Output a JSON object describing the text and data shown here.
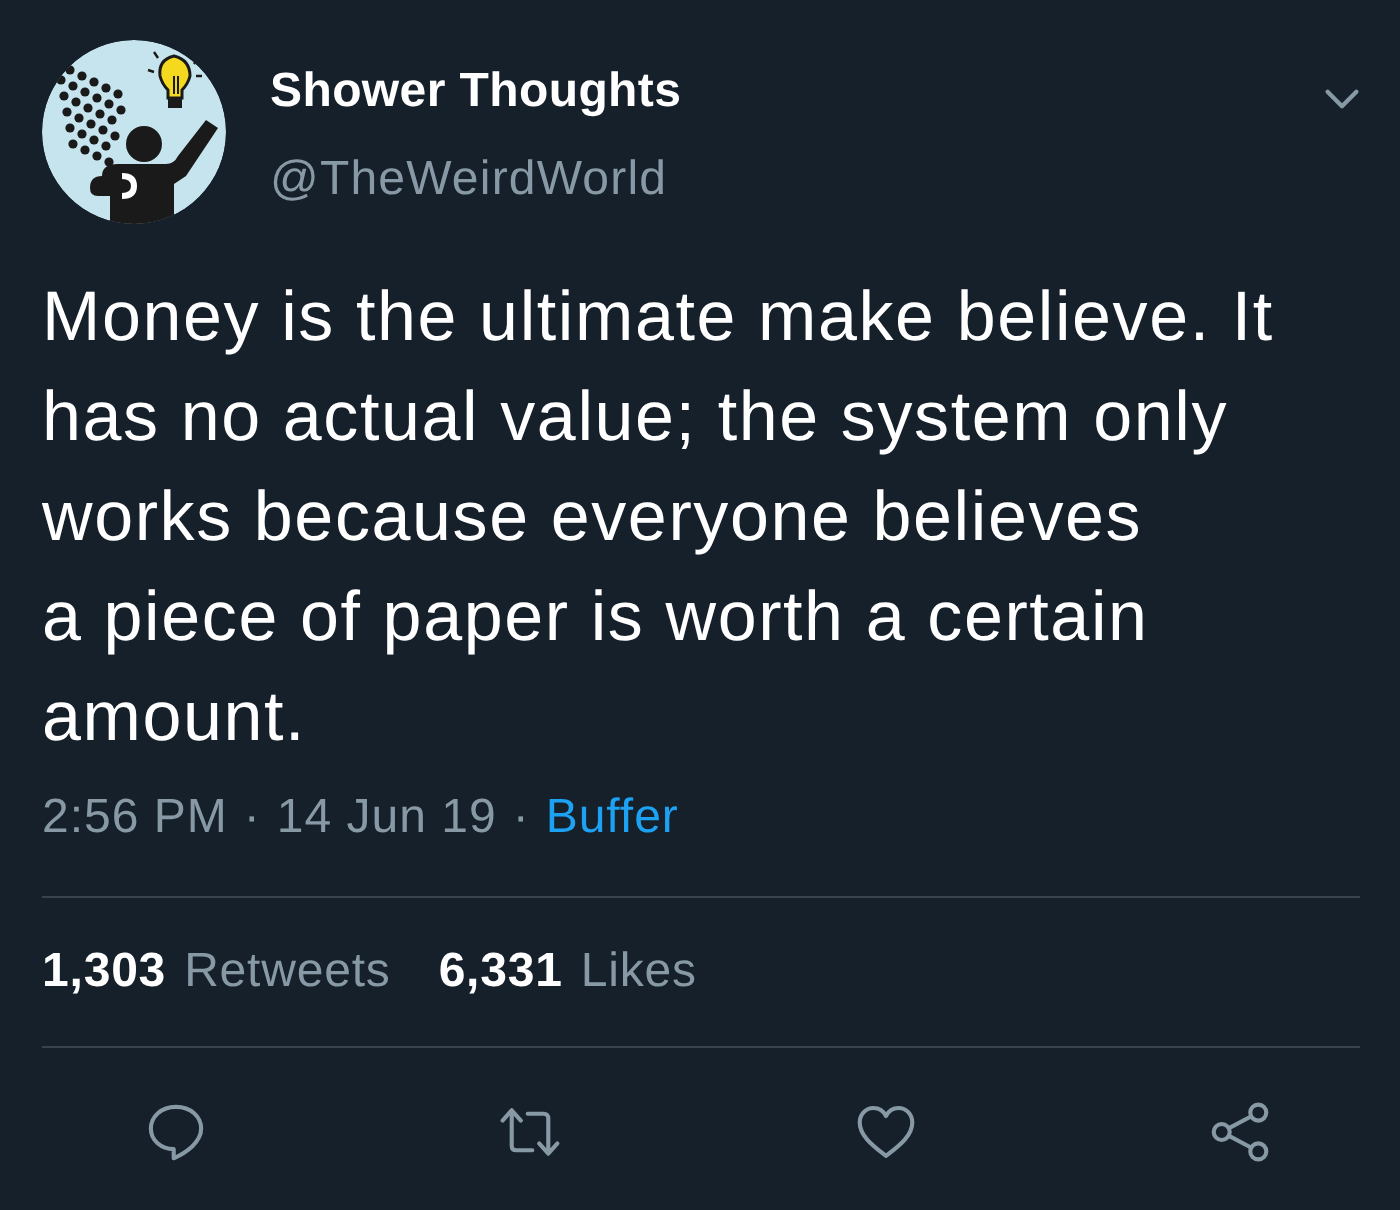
{
  "tweet": {
    "author": {
      "name": "Shower Thoughts",
      "handle": "@TheWeirdWorld"
    },
    "text": "Money is the ultimate make believe. It has no actual value; the system only works because everyone believes\na piece of paper is worth a certain amount.",
    "meta": [
      {
        "kind": "time",
        "text": "2:56 PM"
      },
      {
        "kind": "separator",
        "text": "·"
      },
      {
        "kind": "date",
        "text": "14 Jun 19"
      },
      {
        "kind": "separator",
        "text": "·"
      },
      {
        "kind": "source",
        "text": "Buffer"
      }
    ],
    "stats": [
      {
        "count": "1,303",
        "label": "Retweets"
      },
      {
        "count": "6,331",
        "label": "Likes"
      }
    ],
    "actions": [
      {
        "kind": "reply"
      },
      {
        "kind": "retweet"
      },
      {
        "kind": "like"
      },
      {
        "kind": "share"
      }
    ]
  }
}
